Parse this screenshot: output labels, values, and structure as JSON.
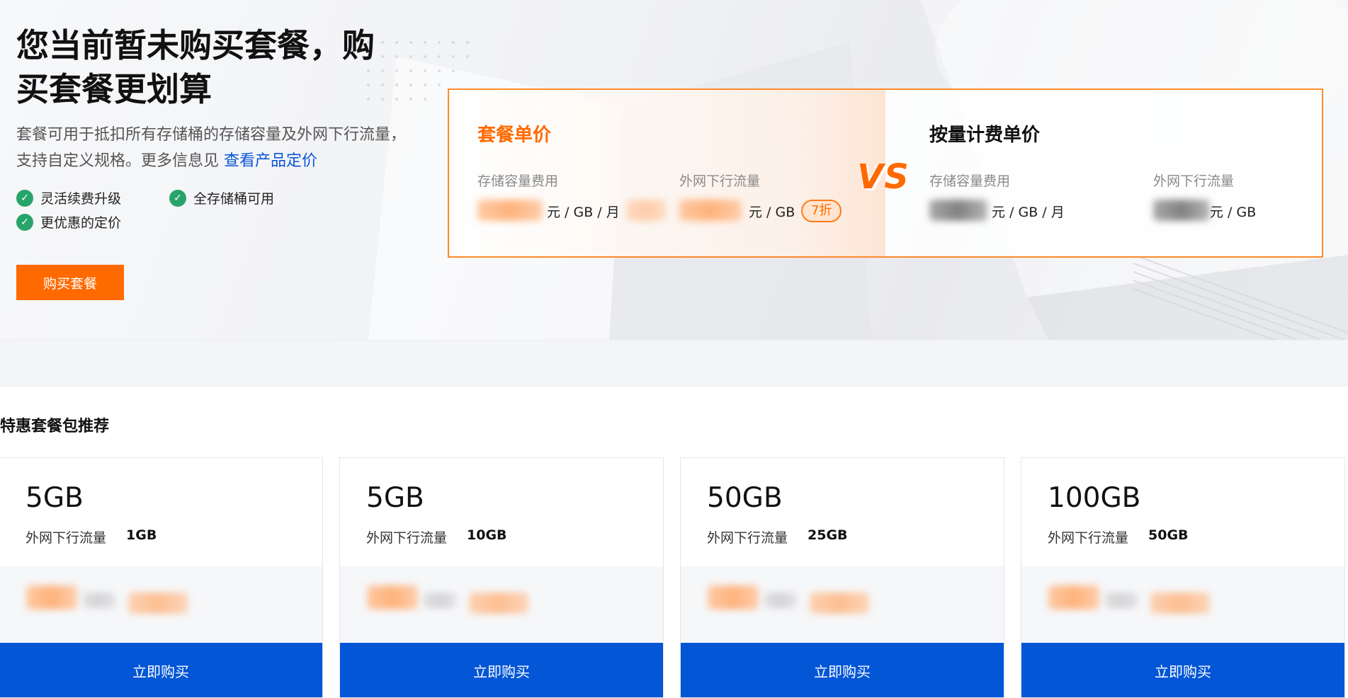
{
  "hero": {
    "title_line1": "您当前暂未购买套餐，购",
    "title_line2": "买套餐更划算",
    "desc_text": "套餐可用于抵扣所有存储桶的存储容量及外网下行流量，支持自定义规格。更多信息见 ",
    "desc_link": "查看产品定价",
    "features": [
      "灵活续费升级",
      "全存储桶可用",
      "更优惠的定价"
    ],
    "buy_button": "购买套餐"
  },
  "compare": {
    "left": {
      "title": "套餐单价",
      "storage_label": "存储容量费用",
      "storage_unit": "元 / GB / 月",
      "traffic_label": "外网下行流量",
      "traffic_unit": "元 / GB",
      "discount_badge": "7折"
    },
    "vs": "VS",
    "right": {
      "title": "按量计费单价",
      "storage_label": "存储容量费用",
      "storage_unit": "元 / GB / 月",
      "traffic_label": "外网下行流量",
      "traffic_unit": "元 / GB"
    }
  },
  "packages": {
    "section_title": "特惠套餐包推荐",
    "traffic_label": "外网下行流量",
    "buy_label": "立即购买",
    "items": [
      {
        "size": "5GB",
        "traffic": "1GB"
      },
      {
        "size": "5GB",
        "traffic": "10GB"
      },
      {
        "size": "50GB",
        "traffic": "25GB"
      },
      {
        "size": "100GB",
        "traffic": "50GB"
      }
    ]
  },
  "colors": {
    "accent_orange": "#ff6a00",
    "primary_blue": "#0356d6",
    "success_green": "#28a46b",
    "link_blue": "#0a55d6"
  }
}
